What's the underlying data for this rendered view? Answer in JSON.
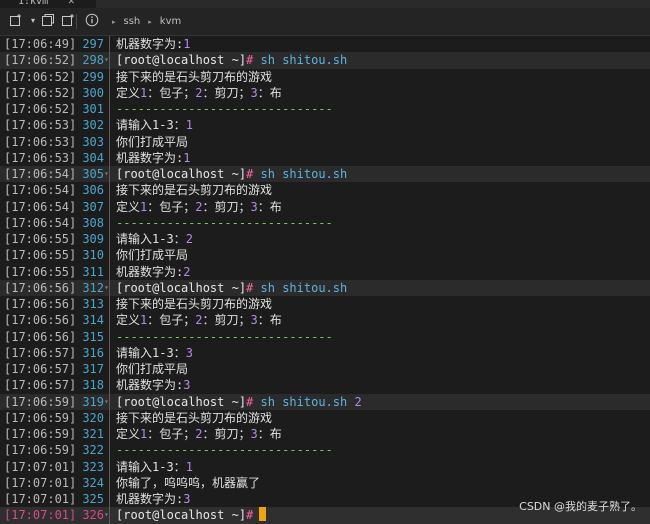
{
  "tab": {
    "label": "1:kvm",
    "close": "✕"
  },
  "toolbar": {
    "breadcrumb": [
      "ssh",
      "kvm"
    ],
    "arrow": "▸"
  },
  "terminal": {
    "lines": [
      {
        "ts": "[17:06:49]",
        "ln": "297",
        "kind": "out",
        "parts": [
          {
            "t": "机器数字为:"
          },
          {
            "t": "1",
            "c": "num"
          }
        ]
      },
      {
        "ts": "[17:06:52]",
        "ln": "298",
        "kind": "cmd",
        "parts": [
          {
            "t": "[root@localhost ~]",
            "c": "prompt"
          },
          {
            "t": "#",
            "c": "hash"
          },
          {
            "t": " "
          },
          {
            "t": "sh shitou.sh",
            "c": "cmdtext"
          }
        ]
      },
      {
        "ts": "[17:06:52]",
        "ln": "299",
        "kind": "out",
        "parts": [
          {
            "t": "接下来的是石头剪刀布的游戏"
          }
        ]
      },
      {
        "ts": "[17:06:52]",
        "ln": "300",
        "kind": "out",
        "parts": [
          {
            "t": "定义"
          },
          {
            "t": "1",
            "c": "num"
          },
          {
            "t": "：包子；"
          },
          {
            "t": "2",
            "c": "num"
          },
          {
            "t": "：剪刀；"
          },
          {
            "t": "3",
            "c": "num"
          },
          {
            "t": "：布"
          }
        ]
      },
      {
        "ts": "[17:06:52]",
        "ln": "301",
        "kind": "out",
        "parts": [
          {
            "t": "------------------------------",
            "c": "dashes"
          }
        ]
      },
      {
        "ts": "[17:06:53]",
        "ln": "302",
        "kind": "out",
        "parts": [
          {
            "t": "请输入1-3："
          },
          {
            "t": "1",
            "c": "num"
          }
        ]
      },
      {
        "ts": "[17:06:53]",
        "ln": "303",
        "kind": "out",
        "parts": [
          {
            "t": "你们打成平局"
          }
        ]
      },
      {
        "ts": "[17:06:53]",
        "ln": "304",
        "kind": "out",
        "parts": [
          {
            "t": "机器数字为:"
          },
          {
            "t": "1",
            "c": "num"
          }
        ]
      },
      {
        "ts": "[17:06:54]",
        "ln": "305",
        "kind": "cmd",
        "parts": [
          {
            "t": "[root@localhost ~]",
            "c": "prompt"
          },
          {
            "t": "#",
            "c": "hash"
          },
          {
            "t": " "
          },
          {
            "t": "sh shitou.sh",
            "c": "cmdtext"
          }
        ]
      },
      {
        "ts": "[17:06:54]",
        "ln": "306",
        "kind": "out",
        "parts": [
          {
            "t": "接下来的是石头剪刀布的游戏"
          }
        ]
      },
      {
        "ts": "[17:06:54]",
        "ln": "307",
        "kind": "out",
        "parts": [
          {
            "t": "定义"
          },
          {
            "t": "1",
            "c": "num"
          },
          {
            "t": "：包子；"
          },
          {
            "t": "2",
            "c": "num"
          },
          {
            "t": "：剪刀；"
          },
          {
            "t": "3",
            "c": "num"
          },
          {
            "t": "：布"
          }
        ]
      },
      {
        "ts": "[17:06:54]",
        "ln": "308",
        "kind": "out",
        "parts": [
          {
            "t": "------------------------------",
            "c": "dashes"
          }
        ]
      },
      {
        "ts": "[17:06:55]",
        "ln": "309",
        "kind": "out",
        "parts": [
          {
            "t": "请输入1-3："
          },
          {
            "t": "2",
            "c": "num"
          }
        ]
      },
      {
        "ts": "[17:06:55]",
        "ln": "310",
        "kind": "out",
        "parts": [
          {
            "t": "你们打成平局"
          }
        ]
      },
      {
        "ts": "[17:06:55]",
        "ln": "311",
        "kind": "out",
        "parts": [
          {
            "t": "机器数字为:"
          },
          {
            "t": "2",
            "c": "num"
          }
        ]
      },
      {
        "ts": "[17:06:56]",
        "ln": "312",
        "kind": "cmd",
        "parts": [
          {
            "t": "[root@localhost ~]",
            "c": "prompt"
          },
          {
            "t": "#",
            "c": "hash"
          },
          {
            "t": " "
          },
          {
            "t": "sh shitou.sh",
            "c": "cmdtext"
          }
        ]
      },
      {
        "ts": "[17:06:56]",
        "ln": "313",
        "kind": "out",
        "parts": [
          {
            "t": "接下来的是石头剪刀布的游戏"
          }
        ]
      },
      {
        "ts": "[17:06:56]",
        "ln": "314",
        "kind": "out",
        "parts": [
          {
            "t": "定义"
          },
          {
            "t": "1",
            "c": "num"
          },
          {
            "t": "：包子；"
          },
          {
            "t": "2",
            "c": "num"
          },
          {
            "t": "：剪刀；"
          },
          {
            "t": "3",
            "c": "num"
          },
          {
            "t": "：布"
          }
        ]
      },
      {
        "ts": "[17:06:56]",
        "ln": "315",
        "kind": "out",
        "parts": [
          {
            "t": "------------------------------",
            "c": "dashes"
          }
        ]
      },
      {
        "ts": "[17:06:57]",
        "ln": "316",
        "kind": "out",
        "parts": [
          {
            "t": "请输入1-3："
          },
          {
            "t": "3",
            "c": "num"
          }
        ]
      },
      {
        "ts": "[17:06:57]",
        "ln": "317",
        "kind": "out",
        "parts": [
          {
            "t": "你们打成平局"
          }
        ]
      },
      {
        "ts": "[17:06:57]",
        "ln": "318",
        "kind": "out",
        "parts": [
          {
            "t": "机器数字为:"
          },
          {
            "t": "3",
            "c": "num"
          }
        ]
      },
      {
        "ts": "[17:06:59]",
        "ln": "319",
        "kind": "cmd",
        "parts": [
          {
            "t": "[root@localhost ~]",
            "c": "prompt"
          },
          {
            "t": "#",
            "c": "hash"
          },
          {
            "t": " "
          },
          {
            "t": "sh shitou.sh",
            "c": "cmdtext"
          },
          {
            "t": " "
          },
          {
            "t": "2",
            "c": "arg"
          }
        ]
      },
      {
        "ts": "[17:06:59]",
        "ln": "320",
        "kind": "out",
        "parts": [
          {
            "t": "接下来的是石头剪刀布的游戏"
          }
        ]
      },
      {
        "ts": "[17:06:59]",
        "ln": "321",
        "kind": "out",
        "parts": [
          {
            "t": "定义"
          },
          {
            "t": "1",
            "c": "num"
          },
          {
            "t": "：包子；"
          },
          {
            "t": "2",
            "c": "num"
          },
          {
            "t": "：剪刀；"
          },
          {
            "t": "3",
            "c": "num"
          },
          {
            "t": "：布"
          }
        ]
      },
      {
        "ts": "[17:06:59]",
        "ln": "322",
        "kind": "out",
        "parts": [
          {
            "t": "------------------------------",
            "c": "dashes"
          }
        ]
      },
      {
        "ts": "[17:07:01]",
        "ln": "323",
        "kind": "out",
        "parts": [
          {
            "t": "请输入1-3："
          },
          {
            "t": "1",
            "c": "num"
          }
        ]
      },
      {
        "ts": "[17:07:01]",
        "ln": "324",
        "kind": "out",
        "parts": [
          {
            "t": "你输了，呜呜呜，机器赢了"
          }
        ]
      },
      {
        "ts": "[17:07:01]",
        "ln": "325",
        "kind": "out",
        "parts": [
          {
            "t": "机器数字为:"
          },
          {
            "t": "3",
            "c": "num"
          }
        ]
      },
      {
        "ts": "[17:07:01]",
        "ln": "326",
        "kind": "cur",
        "parts": [
          {
            "t": "[root@localhost ~]",
            "c": "prompt"
          },
          {
            "t": "#",
            "c": "hash"
          }
        ]
      }
    ]
  },
  "watermark": "CSDN @我的麦子熟了。",
  "colors": {
    "accent": "#e0337e",
    "prompt_hash": "#ff5fa2",
    "command": "#5db4e0",
    "number": "#b58ae6",
    "dashes": "#7ec46b",
    "line_number": "#4aa6c8",
    "cursor": "#f0a30a"
  }
}
